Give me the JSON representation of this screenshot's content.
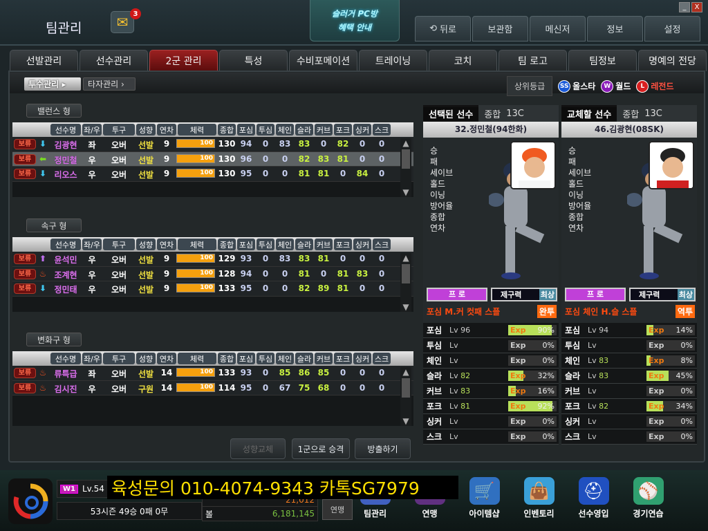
{
  "header": {
    "title": "팀관리",
    "mail_count": "3",
    "promo_line1": "슬러거 PC방",
    "promo_line2": "혜택 안내",
    "nav": [
      {
        "label": "뒤로",
        "icon": "back-arrow-icon"
      },
      {
        "label": "보관함"
      },
      {
        "label": "메신저"
      },
      {
        "label": "정보"
      },
      {
        "label": "설정"
      }
    ],
    "minimize": "_",
    "close": "X"
  },
  "tabs": [
    {
      "label": "선발관리"
    },
    {
      "label": "선수관리"
    },
    {
      "label": "2군 관리",
      "active": true
    },
    {
      "label": "특성"
    },
    {
      "label": "수비포메이션"
    },
    {
      "label": "트레이닝"
    },
    {
      "label": "코치"
    },
    {
      "label": "팀 로고"
    },
    {
      "label": "팀정보"
    },
    {
      "label": "명예의 전당"
    }
  ],
  "subtabs": {
    "pitcher": "투수관리 ▸",
    "batter": "타자관리 ›"
  },
  "grades": {
    "label": "상위등급",
    "items": [
      {
        "badge": "SS",
        "label": "올스타",
        "color": "#1a5ad8",
        "text": "#ffffff"
      },
      {
        "badge": "W",
        "label": "월드",
        "color": "#8a1ab8",
        "text": "#ffffff"
      },
      {
        "badge": "L",
        "label": "레전드",
        "color": "#d82020",
        "text": "#ff5040"
      }
    ]
  },
  "columns": [
    "선수명",
    "좌/우",
    "투구",
    "성향",
    "연차",
    "체력",
    "종합",
    "포심",
    "투심",
    "체인",
    "슬라",
    "커브",
    "포크",
    "싱커",
    "스크"
  ],
  "groups": [
    {
      "label": "밸런스 형",
      "rows": [
        {
          "status": "보류",
          "arrow": "down",
          "name": "김광현",
          "hand": "좌",
          "pitch": "오버",
          "role": "선발",
          "year": "9",
          "stamina": 100,
          "overall": "130",
          "stats": [
            "94",
            "0",
            "83",
            "83",
            "0",
            "82",
            "0",
            "0"
          ],
          "hl": [
            3,
            5
          ]
        },
        {
          "status": "보류",
          "arrow": "left",
          "name": "정민철",
          "hand": "우",
          "pitch": "오버",
          "role": "선발",
          "year": "9",
          "stamina": 100,
          "overall": "130",
          "stats": [
            "96",
            "0",
            "0",
            "82",
            "83",
            "81",
            "0",
            "0"
          ],
          "hl": [
            3,
            4,
            5
          ],
          "selected": true
        },
        {
          "status": "보류",
          "arrow": "down",
          "name": "리오스",
          "hand": "우",
          "pitch": "오버",
          "role": "선발",
          "year": "9",
          "stamina": 100,
          "overall": "130",
          "stats": [
            "95",
            "0",
            "0",
            "81",
            "81",
            "0",
            "84",
            "0"
          ],
          "hl": [
            3,
            4,
            6
          ]
        }
      ]
    },
    {
      "label": "속구 형",
      "rows": [
        {
          "status": "보류",
          "arrow": "up",
          "name": "윤석민",
          "hand": "우",
          "pitch": "오버",
          "role": "선발",
          "year": "9",
          "stamina": 100,
          "overall": "129",
          "stats": [
            "93",
            "0",
            "83",
            "83",
            "81",
            "0",
            "0",
            "0"
          ],
          "hl": [
            3,
            4
          ]
        },
        {
          "status": "보류",
          "arrow": "hot",
          "name": "조계현",
          "hand": "우",
          "pitch": "오버",
          "role": "선발",
          "year": "9",
          "stamina": 100,
          "overall": "128",
          "stats": [
            "94",
            "0",
            "0",
            "81",
            "0",
            "81",
            "83",
            "0"
          ],
          "hl": [
            3,
            5,
            6
          ]
        },
        {
          "status": "보류",
          "arrow": "down",
          "name": "정민태",
          "hand": "우",
          "pitch": "오버",
          "role": "선발",
          "year": "9",
          "stamina": 100,
          "overall": "133",
          "stats": [
            "95",
            "0",
            "0",
            "82",
            "89",
            "81",
            "0",
            "0"
          ],
          "hl": [
            3,
            4,
            5
          ]
        }
      ]
    },
    {
      "label": "변화구 형",
      "rows": [
        {
          "status": "보류",
          "arrow": "hot",
          "name": "류특급",
          "hand": "좌",
          "pitch": "오버",
          "role": "선발",
          "year": "14",
          "stamina": 100,
          "overall": "133",
          "stats": [
            "93",
            "0",
            "85",
            "86",
            "85",
            "0",
            "0",
            "0"
          ],
          "hl": [
            2,
            3,
            4
          ]
        },
        {
          "status": "보류",
          "arrow": "hot",
          "name": "김시진",
          "hand": "우",
          "pitch": "오버",
          "role": "구원",
          "year": "14",
          "stamina": 100,
          "overall": "114",
          "stats": [
            "95",
            "0",
            "67",
            "75",
            "68",
            "0",
            "0",
            "0"
          ],
          "hl": [
            3,
            4
          ]
        }
      ]
    }
  ],
  "actions": {
    "change_type": "성향교체",
    "promote": "1군으로 승격",
    "release": "방출하기"
  },
  "stat_labels": [
    "승",
    "패",
    "세이브",
    "홀드",
    "이닝",
    "방어율",
    "종합",
    "연차"
  ],
  "compare": [
    {
      "heading": "선택된 선수",
      "overall_label": "종합",
      "overall": "13C",
      "player": "32.정민철(94한화)",
      "grade": "프 로",
      "control_label": "제구력",
      "control": "최상",
      "pitch_line": "포심 M.커 컷패 스플",
      "pitch_tag": "완투",
      "skills": [
        {
          "name": "포심",
          "lv": "96",
          "exp": 90
        },
        {
          "name": "투심",
          "lv": "",
          "exp": 0
        },
        {
          "name": "체인",
          "lv": "",
          "exp": 0
        },
        {
          "name": "슬라",
          "lv": "82",
          "exp": 32
        },
        {
          "name": "커브",
          "lv": "83",
          "exp": 16
        },
        {
          "name": "포크",
          "lv": "81",
          "exp": 92
        },
        {
          "name": "싱커",
          "lv": "",
          "exp": 0
        },
        {
          "name": "스크",
          "lv": "",
          "exp": 0
        }
      ]
    },
    {
      "heading": "교체할 선수",
      "overall_label": "종합",
      "overall": "13C",
      "player": "46.김광현(08SK)",
      "grade": "프 로",
      "control_label": "제구력",
      "control": "최상",
      "pitch_line": "포심 체인 H.슬 스플",
      "pitch_tag": "역투",
      "skills": [
        {
          "name": "포심",
          "lv": "94",
          "exp": 14
        },
        {
          "name": "투심",
          "lv": "",
          "exp": 0
        },
        {
          "name": "체인",
          "lv": "83",
          "exp": 8
        },
        {
          "name": "슬라",
          "lv": "83",
          "exp": 45
        },
        {
          "name": "커브",
          "lv": "",
          "exp": 0
        },
        {
          "name": "포크",
          "lv": "82",
          "exp": 34
        },
        {
          "name": "싱커",
          "lv": "",
          "exp": 0
        },
        {
          "name": "스크",
          "lv": "",
          "exp": 0
        }
      ]
    }
  ],
  "skill_lv_label": "Lv",
  "skill_exp_label": "Exp",
  "bottom": {
    "tier": "W1",
    "level": "Lv.54",
    "record": "53시즌  49승  0패  0무",
    "money1": "21,012",
    "money2_label": "볼",
    "money2": "6,181,145",
    "league": "연맹",
    "menu": [
      {
        "label": "팀관리",
        "icon": "team-manage-icon"
      },
      {
        "label": "연맹",
        "icon": "league-icon"
      },
      {
        "label": "아이템샵",
        "icon": "shop-icon"
      },
      {
        "label": "인벤토리",
        "icon": "inventory-icon"
      },
      {
        "label": "선수영입",
        "icon": "recruit-icon"
      },
      {
        "label": "경기연습",
        "icon": "practice-icon"
      }
    ],
    "banner": "육성문의 010-4074-9343 카톡SG7979"
  }
}
